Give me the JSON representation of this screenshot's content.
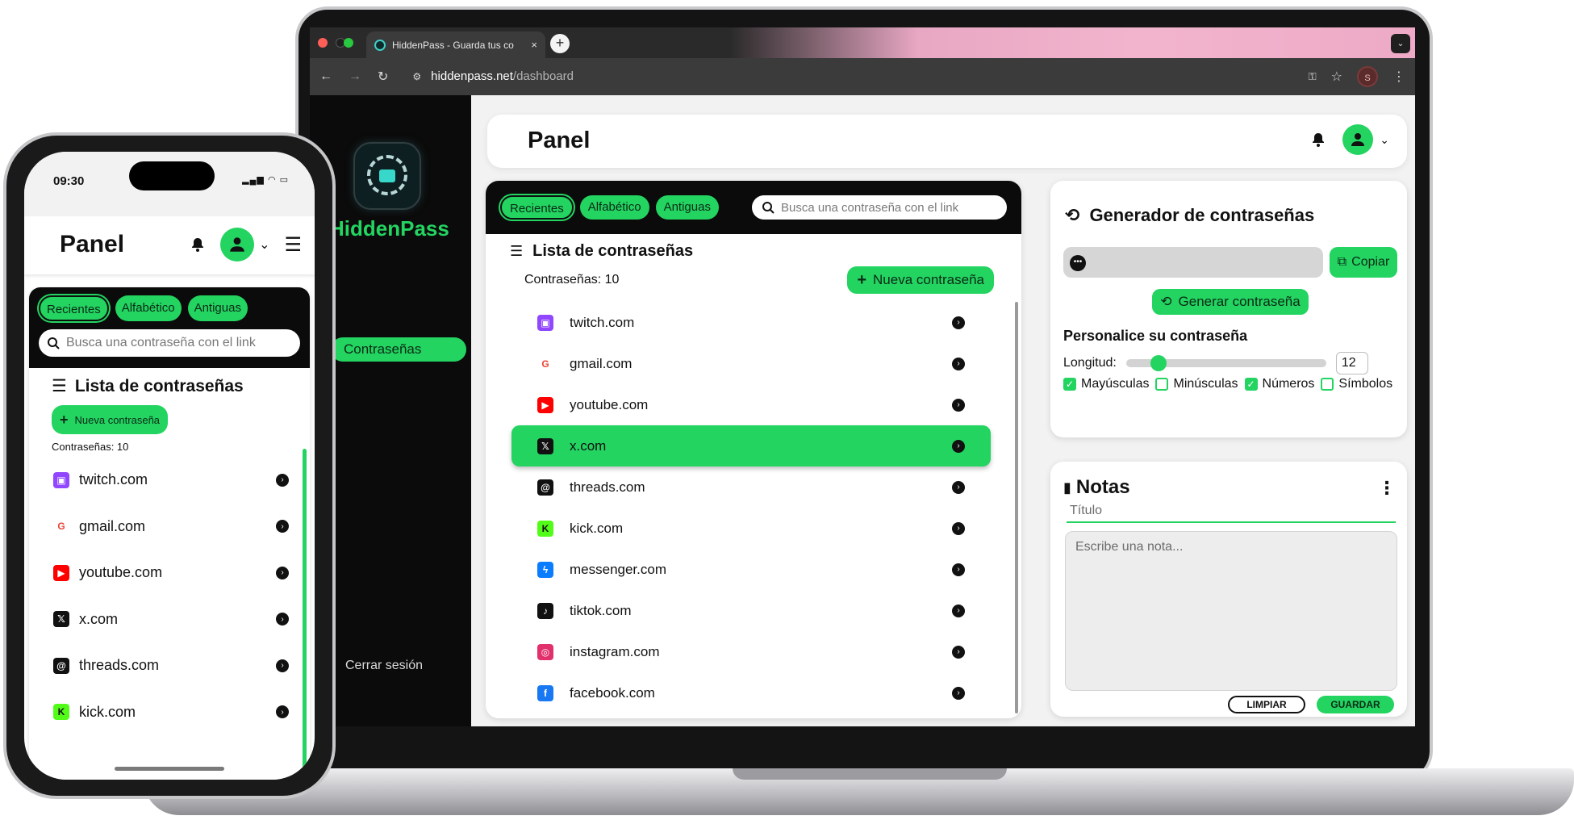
{
  "browser": {
    "tab_title": "HiddenPass - Guarda tus co",
    "tab_close": "×",
    "new_tab": "+",
    "url_host": "hiddenpass.net",
    "url_path": "/dashboard",
    "profile_initial": "S"
  },
  "app": {
    "brand": "HiddenPass",
    "nav_active": "Contraseñas",
    "logout": "Cerrar sesión",
    "page_title": "Panel",
    "filters": [
      "Recientes",
      "Alfabético",
      "Antiguas"
    ],
    "search_placeholder": "Busca una contraseña con el link",
    "list_title": "Lista de contraseñas",
    "count_label": "Contraseñas: 10",
    "new_button": "Nueva contraseña",
    "items": [
      {
        "site": "twitch.com",
        "icon": "twitch-icon",
        "color": "#9146ff"
      },
      {
        "site": "gmail.com",
        "icon": "google-icon",
        "color": "#ea4335"
      },
      {
        "site": "youtube.com",
        "icon": "youtube-icon",
        "color": "#ff0000"
      },
      {
        "site": "x.com",
        "icon": "x-icon",
        "color": "#111111"
      },
      {
        "site": "threads.com",
        "icon": "threads-icon",
        "color": "#111111"
      },
      {
        "site": "kick.com",
        "icon": "kick-icon",
        "color": "#53fc18"
      },
      {
        "site": "messenger.com",
        "icon": "messenger-icon",
        "color": "#0a7cff"
      },
      {
        "site": "tiktok.com",
        "icon": "tiktok-icon",
        "color": "#111111"
      },
      {
        "site": "instagram.com",
        "icon": "instagram-icon",
        "color": "#e1306c"
      },
      {
        "site": "facebook.com",
        "icon": "facebook-icon",
        "color": "#1877f2"
      }
    ],
    "selected_item": "x.com",
    "generator": {
      "title": "Generador de contraseñas",
      "copy": "Copiar",
      "generate": "Generar contraseña",
      "customize": "Personalice su contraseña",
      "length_label": "Longitud:",
      "length_value": "12",
      "length_fraction": 0.12,
      "options": [
        {
          "label": "Mayúsculas",
          "checked": true
        },
        {
          "label": "Minúsculas",
          "checked": false
        },
        {
          "label": "Números",
          "checked": true
        },
        {
          "label": "Símbolos",
          "checked": false
        }
      ]
    },
    "notes": {
      "title": "Notas",
      "title_placeholder": "Título",
      "body_placeholder": "Escribe una nota...",
      "clear": "LIMPIAR",
      "save": "GUARDAR"
    }
  },
  "phone": {
    "time": "09:30",
    "page_title": "Panel",
    "filters": [
      "Recientes",
      "Alfabético",
      "Antiguas"
    ],
    "search_placeholder": "Busca una contraseña con el link",
    "list_title": "Lista de contraseñas",
    "new_button": "Nueva contraseña",
    "count_label": "Contraseñas: 10",
    "items": [
      "twitch.com",
      "gmail.com",
      "youtube.com",
      "x.com",
      "threads.com",
      "kick.com"
    ]
  },
  "colors": {
    "accent": "#23d461",
    "sidebar": "#0b0b0b"
  }
}
